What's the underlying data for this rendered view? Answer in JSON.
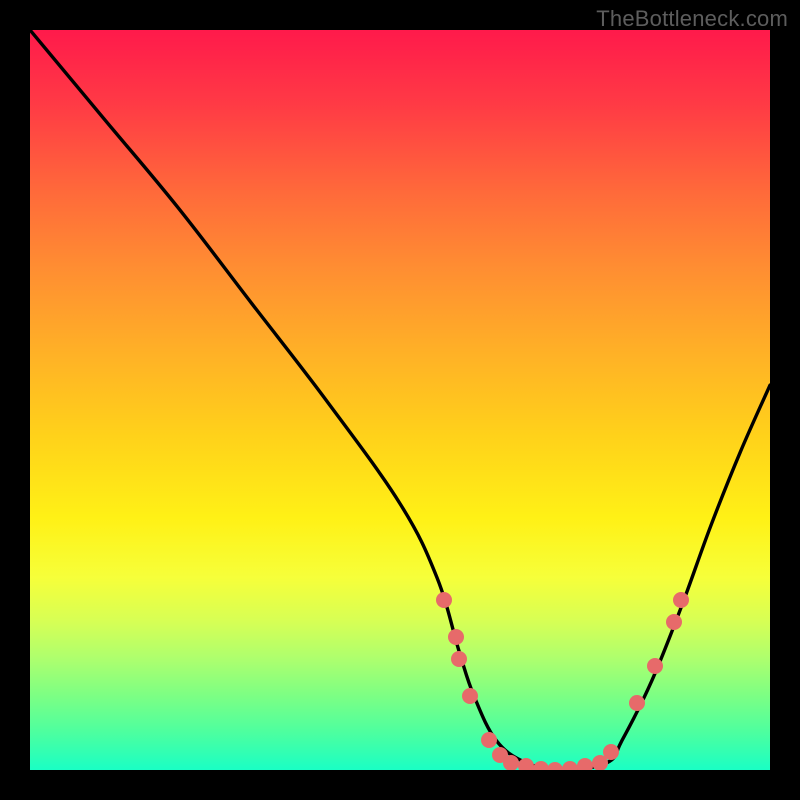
{
  "watermark": "TheBottleneck.com",
  "chart_data": {
    "type": "line",
    "title": "",
    "xlabel": "",
    "ylabel": "",
    "xlim": [
      0,
      100
    ],
    "ylim": [
      0,
      100
    ],
    "grid": false,
    "legend": false,
    "series": [
      {
        "name": "bottleneck-curve",
        "x": [
          0,
          10,
          20,
          30,
          40,
          50,
          55,
          58,
          60,
          63,
          67,
          72,
          78,
          80,
          84,
          88,
          92,
          96,
          100
        ],
        "values": [
          100,
          88,
          76,
          63,
          50,
          36,
          26,
          16,
          10,
          4,
          1,
          0,
          1,
          4,
          12,
          22,
          33,
          43,
          52
        ]
      }
    ],
    "points": [
      {
        "x": 56.0,
        "y": 23.0
      },
      {
        "x": 57.5,
        "y": 18.0
      },
      {
        "x": 58.0,
        "y": 15.0
      },
      {
        "x": 59.5,
        "y": 10.0
      },
      {
        "x": 62.0,
        "y": 4.0
      },
      {
        "x": 63.5,
        "y": 2.0
      },
      {
        "x": 65.0,
        "y": 1.0
      },
      {
        "x": 67.0,
        "y": 0.5
      },
      {
        "x": 69.0,
        "y": 0.2
      },
      {
        "x": 71.0,
        "y": 0.0
      },
      {
        "x": 73.0,
        "y": 0.2
      },
      {
        "x": 75.0,
        "y": 0.6
      },
      {
        "x": 77.0,
        "y": 1.0
      },
      {
        "x": 78.5,
        "y": 2.5
      },
      {
        "x": 82.0,
        "y": 9.0
      },
      {
        "x": 84.5,
        "y": 14.0
      },
      {
        "x": 87.0,
        "y": 20.0
      },
      {
        "x": 88.0,
        "y": 23.0
      }
    ],
    "colors": {
      "curve": "#000000",
      "dot": "#e76a6a",
      "gradient_top": "#ff1a4b",
      "gradient_bottom": "#1affc4"
    }
  }
}
